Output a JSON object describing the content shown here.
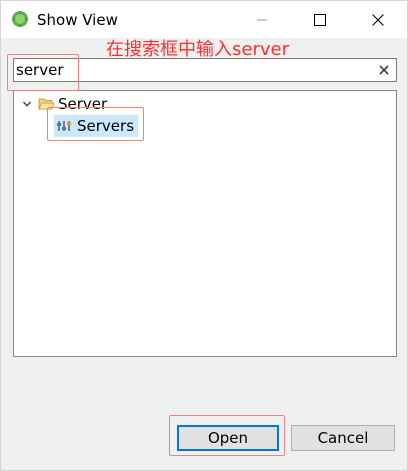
{
  "window": {
    "title": "Show View"
  },
  "annotation": {
    "text": "在搜索框中输入server",
    "color": "#ff2f2f"
  },
  "search": {
    "value": "server",
    "placeholder": ""
  },
  "tree": {
    "nodes": [
      {
        "label": "Server",
        "expanded": true,
        "icon": "folder-open-icon",
        "children": [
          {
            "label": "Servers",
            "icon": "servers-view-icon",
            "selected": true
          }
        ]
      }
    ]
  },
  "buttons": {
    "open_label": "Open",
    "cancel_label": "Cancel"
  },
  "colors": {
    "highlight_outline": "#f08080",
    "selection": "#cce8ff",
    "default_button_border": "#0078d7"
  }
}
